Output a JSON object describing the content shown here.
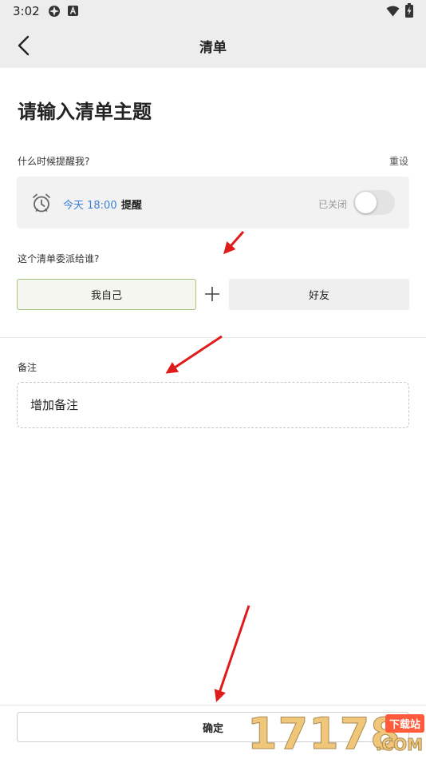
{
  "status_bar": {
    "time": "3:02"
  },
  "app_bar": {
    "title": "清单"
  },
  "topic": {
    "placeholder": "请输入清单主题"
  },
  "reminder": {
    "section_label": "什么时候提醒我?",
    "reset_label": "重设",
    "time_text": "今天 18:00",
    "label": "提醒",
    "status_text": "已关闭",
    "enabled": false
  },
  "assign": {
    "section_label": "这个清单委派给谁?",
    "self_label": "我自己",
    "friend_label": "好友"
  },
  "note": {
    "section_label": "备注",
    "placeholder": "增加备注"
  },
  "footer": {
    "confirm_label": "确定"
  },
  "watermark": {
    "digits": "17178",
    "tag": "下载站",
    "suffix": ".COM"
  },
  "colors": {
    "accent_blue": "#3d7fd6",
    "selected_border": "#a6c47c",
    "annotation_red": "#e01b1b",
    "bar_background": "#ededed"
  }
}
